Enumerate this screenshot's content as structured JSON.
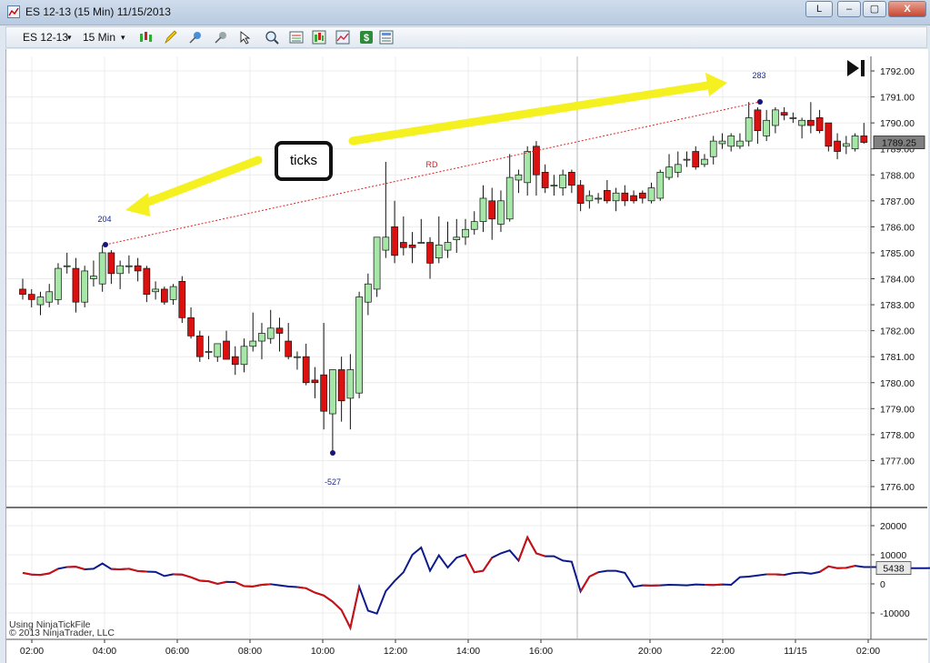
{
  "window": {
    "title": "ES 12-13 (15 Min)  11/15/2013",
    "buttons": [
      "L",
      "–",
      "▢",
      "X"
    ]
  },
  "toolbar": {
    "instrument": "ES 12-13",
    "interval": "15 Min",
    "icons": [
      "bar-style-icon",
      "pencil-draw-icon",
      "pin-icon",
      "pin-gray-icon",
      "pointer-icon",
      "zoom-icon",
      "data-box-icon",
      "chart-style-icon",
      "strategy-icon",
      "money-icon",
      "properties-icon"
    ]
  },
  "annotation": {
    "callout": "ticks",
    "start_value": "204",
    "end_value": "283",
    "low_value": "-527",
    "line_label": "RD"
  },
  "price_panel": {
    "ticks": [
      "1792.00",
      "1791.00",
      "1790.00",
      "1789.00",
      "1788.00",
      "1787.00",
      "1786.00",
      "1785.00",
      "1784.00",
      "1783.00",
      "1782.00",
      "1781.00",
      "1780.00",
      "1779.00",
      "1778.00",
      "1777.00",
      "1776.00"
    ],
    "last_price": "1789.25"
  },
  "indicator_panel": {
    "ticks": [
      "20000",
      "10000",
      "0",
      "-10000"
    ],
    "last_value": "5438"
  },
  "time_axis": [
    "02:00",
    "04:00",
    "06:00",
    "08:00",
    "10:00",
    "12:00",
    "14:00",
    "16:00",
    "20:00",
    "22:00",
    "11/15",
    "02:00"
  ],
  "credits": {
    "line1": "Using NinjaTickFile",
    "line2": "© 2013 NinjaTrader, LLC"
  },
  "colors": {
    "up_candle": "#a6e6a6",
    "down_candle": "#dd1010",
    "indicator_blue": "#0d1a8a",
    "indicator_red": "#cc1111",
    "arrow_yellow": "#f5f020"
  },
  "chart_data": {
    "type": "candlestick",
    "x_axis": "time (15-min bars)",
    "y_range": [
      1775.5,
      1792.5
    ],
    "candles": [
      {
        "o": 1783.6,
        "h": 1784.0,
        "l": 1783.2,
        "c": 1783.4
      },
      {
        "o": 1783.4,
        "h": 1783.6,
        "l": 1782.9,
        "c": 1783.2
      },
      {
        "o": 1783.0,
        "h": 1783.5,
        "l": 1782.6,
        "c": 1783.3
      },
      {
        "o": 1783.1,
        "h": 1783.8,
        "l": 1782.9,
        "c": 1783.5
      },
      {
        "o": 1783.2,
        "h": 1784.6,
        "l": 1783.0,
        "c": 1784.4
      },
      {
        "o": 1784.5,
        "h": 1785.0,
        "l": 1784.2,
        "c": 1784.5
      },
      {
        "o": 1784.4,
        "h": 1784.8,
        "l": 1782.7,
        "c": 1783.1
      },
      {
        "o": 1783.1,
        "h": 1784.5,
        "l": 1782.9,
        "c": 1784.3
      },
      {
        "o": 1784.0,
        "h": 1784.7,
        "l": 1783.7,
        "c": 1784.1
      },
      {
        "o": 1783.8,
        "h": 1785.3,
        "l": 1783.5,
        "c": 1785.0
      },
      {
        "o": 1785.0,
        "h": 1785.1,
        "l": 1783.8,
        "c": 1784.2
      },
      {
        "o": 1784.2,
        "h": 1784.7,
        "l": 1783.6,
        "c": 1784.5
      },
      {
        "o": 1784.5,
        "h": 1784.9,
        "l": 1784.2,
        "c": 1784.5
      },
      {
        "o": 1784.5,
        "h": 1784.8,
        "l": 1783.9,
        "c": 1784.3
      },
      {
        "o": 1784.4,
        "h": 1784.5,
        "l": 1783.1,
        "c": 1783.4
      },
      {
        "o": 1783.5,
        "h": 1783.9,
        "l": 1783.2,
        "c": 1783.6
      },
      {
        "o": 1783.6,
        "h": 1783.7,
        "l": 1783.0,
        "c": 1783.1
      },
      {
        "o": 1783.2,
        "h": 1783.8,
        "l": 1783.0,
        "c": 1783.7
      },
      {
        "o": 1783.9,
        "h": 1784.1,
        "l": 1782.3,
        "c": 1782.5
      },
      {
        "o": 1782.5,
        "h": 1782.9,
        "l": 1781.7,
        "c": 1781.8
      },
      {
        "o": 1781.8,
        "h": 1782.0,
        "l": 1780.8,
        "c": 1781.0
      },
      {
        "o": 1781.2,
        "h": 1781.8,
        "l": 1780.9,
        "c": 1781.2
      },
      {
        "o": 1781.0,
        "h": 1781.5,
        "l": 1780.8,
        "c": 1781.5
      },
      {
        "o": 1781.6,
        "h": 1782.0,
        "l": 1780.9,
        "c": 1780.9
      },
      {
        "o": 1781.0,
        "h": 1781.4,
        "l": 1780.3,
        "c": 1780.7
      },
      {
        "o": 1780.7,
        "h": 1781.7,
        "l": 1780.4,
        "c": 1781.4
      },
      {
        "o": 1781.4,
        "h": 1782.7,
        "l": 1781.2,
        "c": 1781.6
      },
      {
        "o": 1781.6,
        "h": 1782.3,
        "l": 1780.9,
        "c": 1781.9
      },
      {
        "o": 1781.7,
        "h": 1782.8,
        "l": 1781.5,
        "c": 1782.1
      },
      {
        "o": 1782.1,
        "h": 1782.5,
        "l": 1781.2,
        "c": 1781.9
      },
      {
        "o": 1781.6,
        "h": 1782.3,
        "l": 1780.9,
        "c": 1781.0
      },
      {
        "o": 1781.0,
        "h": 1781.2,
        "l": 1780.5,
        "c": 1781.0
      },
      {
        "o": 1781.0,
        "h": 1781.5,
        "l": 1779.9,
        "c": 1780.0
      },
      {
        "o": 1780.1,
        "h": 1780.6,
        "l": 1779.4,
        "c": 1780.0
      },
      {
        "o": 1780.3,
        "h": 1782.3,
        "l": 1778.2,
        "c": 1778.9
      },
      {
        "o": 1778.8,
        "h": 1779.3,
        "l": 1777.3,
        "c": 1780.5
      },
      {
        "o": 1780.5,
        "h": 1781.0,
        "l": 1778.5,
        "c": 1779.3
      },
      {
        "o": 1779.4,
        "h": 1781.1,
        "l": 1778.2,
        "c": 1780.5
      },
      {
        "o": 1779.6,
        "h": 1783.5,
        "l": 1779.4,
        "c": 1783.3
      },
      {
        "o": 1783.1,
        "h": 1784.2,
        "l": 1782.6,
        "c": 1783.8
      },
      {
        "o": 1783.6,
        "h": 1785.4,
        "l": 1783.3,
        "c": 1785.6
      },
      {
        "o": 1785.1,
        "h": 1788.5,
        "l": 1784.8,
        "c": 1785.6
      },
      {
        "o": 1786.0,
        "h": 1787.0,
        "l": 1784.6,
        "c": 1784.9
      },
      {
        "o": 1785.4,
        "h": 1786.4,
        "l": 1784.9,
        "c": 1785.2
      },
      {
        "o": 1785.3,
        "h": 1785.8,
        "l": 1784.6,
        "c": 1785.2
      },
      {
        "o": 1785.4,
        "h": 1786.3,
        "l": 1785.4,
        "c": 1785.4
      },
      {
        "o": 1785.4,
        "h": 1785.6,
        "l": 1784.0,
        "c": 1784.6
      },
      {
        "o": 1784.8,
        "h": 1786.4,
        "l": 1784.6,
        "c": 1785.3
      },
      {
        "o": 1785.1,
        "h": 1786.2,
        "l": 1784.8,
        "c": 1785.4
      },
      {
        "o": 1785.5,
        "h": 1786.3,
        "l": 1785.0,
        "c": 1785.6
      },
      {
        "o": 1785.6,
        "h": 1786.3,
        "l": 1785.3,
        "c": 1785.9
      },
      {
        "o": 1785.9,
        "h": 1786.6,
        "l": 1785.7,
        "c": 1786.2
      },
      {
        "o": 1786.2,
        "h": 1787.6,
        "l": 1785.8,
        "c": 1787.1
      },
      {
        "o": 1787.0,
        "h": 1787.5,
        "l": 1785.5,
        "c": 1786.3
      },
      {
        "o": 1786.1,
        "h": 1787.4,
        "l": 1785.8,
        "c": 1787.0
      },
      {
        "o": 1786.3,
        "h": 1788.8,
        "l": 1786.2,
        "c": 1787.9
      },
      {
        "o": 1787.8,
        "h": 1788.2,
        "l": 1787.3,
        "c": 1788.0
      },
      {
        "o": 1787.7,
        "h": 1789.1,
        "l": 1787.2,
        "c": 1788.9
      },
      {
        "o": 1789.1,
        "h": 1789.3,
        "l": 1787.2,
        "c": 1788.0
      },
      {
        "o": 1788.1,
        "h": 1788.4,
        "l": 1787.3,
        "c": 1787.5
      },
      {
        "o": 1787.6,
        "h": 1788.0,
        "l": 1787.2,
        "c": 1787.6
      },
      {
        "o": 1787.5,
        "h": 1788.2,
        "l": 1787.2,
        "c": 1788.0
      },
      {
        "o": 1788.1,
        "h": 1788.2,
        "l": 1787.3,
        "c": 1787.6
      },
      {
        "o": 1787.6,
        "h": 1787.8,
        "l": 1786.6,
        "c": 1786.9
      },
      {
        "o": 1787.0,
        "h": 1787.4,
        "l": 1786.7,
        "c": 1787.2
      },
      {
        "o": 1787.1,
        "h": 1787.3,
        "l": 1786.9,
        "c": 1787.1
      },
      {
        "o": 1787.4,
        "h": 1787.8,
        "l": 1786.9,
        "c": 1787.0
      },
      {
        "o": 1787.0,
        "h": 1787.5,
        "l": 1786.6,
        "c": 1787.3
      },
      {
        "o": 1787.3,
        "h": 1787.6,
        "l": 1786.8,
        "c": 1787.0
      },
      {
        "o": 1787.2,
        "h": 1787.4,
        "l": 1786.9,
        "c": 1787.0
      },
      {
        "o": 1787.3,
        "h": 1787.4,
        "l": 1786.9,
        "c": 1787.1
      },
      {
        "o": 1787.0,
        "h": 1787.7,
        "l": 1786.9,
        "c": 1787.5
      },
      {
        "o": 1787.1,
        "h": 1788.2,
        "l": 1787.0,
        "c": 1788.1
      },
      {
        "o": 1787.9,
        "h": 1788.8,
        "l": 1787.8,
        "c": 1788.3
      },
      {
        "o": 1788.1,
        "h": 1788.9,
        "l": 1787.9,
        "c": 1788.4
      },
      {
        "o": 1788.6,
        "h": 1788.9,
        "l": 1788.3,
        "c": 1788.6
      },
      {
        "o": 1788.9,
        "h": 1789.1,
        "l": 1788.2,
        "c": 1788.3
      },
      {
        "o": 1788.4,
        "h": 1788.8,
        "l": 1788.3,
        "c": 1788.6
      },
      {
        "o": 1788.7,
        "h": 1789.5,
        "l": 1788.4,
        "c": 1789.3
      },
      {
        "o": 1789.2,
        "h": 1789.6,
        "l": 1789.0,
        "c": 1789.3
      },
      {
        "o": 1789.1,
        "h": 1789.6,
        "l": 1788.9,
        "c": 1789.5
      },
      {
        "o": 1789.1,
        "h": 1789.6,
        "l": 1789.0,
        "c": 1789.3
      },
      {
        "o": 1789.3,
        "h": 1790.8,
        "l": 1789.1,
        "c": 1790.2
      },
      {
        "o": 1790.5,
        "h": 1790.6,
        "l": 1789.2,
        "c": 1789.7
      },
      {
        "o": 1789.5,
        "h": 1790.5,
        "l": 1789.3,
        "c": 1790.1
      },
      {
        "o": 1789.9,
        "h": 1790.6,
        "l": 1789.6,
        "c": 1790.5
      },
      {
        "o": 1790.4,
        "h": 1790.6,
        "l": 1790.1,
        "c": 1790.3
      },
      {
        "o": 1790.2,
        "h": 1790.4,
        "l": 1790.0,
        "c": 1790.2
      },
      {
        "o": 1789.9,
        "h": 1790.2,
        "l": 1789.4,
        "c": 1790.1
      },
      {
        "o": 1790.1,
        "h": 1790.8,
        "l": 1789.6,
        "c": 1789.9
      },
      {
        "o": 1790.2,
        "h": 1790.5,
        "l": 1789.6,
        "c": 1789.7
      },
      {
        "o": 1790.0,
        "h": 1790.0,
        "l": 1788.9,
        "c": 1789.1
      },
      {
        "o": 1789.3,
        "h": 1789.6,
        "l": 1788.6,
        "c": 1788.9
      },
      {
        "o": 1789.1,
        "h": 1789.5,
        "l": 1788.8,
        "c": 1789.2
      },
      {
        "o": 1789.0,
        "h": 1789.6,
        "l": 1788.9,
        "c": 1789.5
      },
      {
        "o": 1789.5,
        "h": 1790.0,
        "l": 1789.2,
        "c": 1789.25
      }
    ],
    "indicator_y_range": [
      -15000,
      24000
    ],
    "indicator": [
      3800,
      3200,
      3100,
      3600,
      5200,
      5800,
      5900,
      5000,
      5200,
      7000,
      5100,
      5000,
      5200,
      4400,
      4200,
      4100,
      2700,
      3300,
      3200,
      2300,
      1100,
      900,
      0,
      700,
      600,
      -800,
      -900,
      -300,
      -100,
      -500,
      -900,
      -1100,
      -1500,
      -3000,
      -4000,
      -6100,
      -9000,
      -15100,
      -1000,
      -9200,
      -10200,
      -2500,
      1000,
      4000,
      10000,
      12500,
      4500,
      9800,
      5600,
      9000,
      10000,
      4000,
      4500,
      9000,
      10500,
      11500,
      8000,
      16000,
      10500,
      9500,
      9500,
      8000,
      7600,
      -2600,
      2500,
      4000,
      4500,
      4500,
      3800,
      -1000,
      -500,
      -600,
      -500,
      -300,
      -400,
      -500,
      -200,
      -300,
      -400,
      -200,
      -300,
      2300,
      2500,
      2900,
      3300,
      3300,
      3100,
      3700,
      3900,
      3500,
      4100,
      6000,
      5400,
      5500,
      6200,
      5800,
      5800,
      5800,
      5600,
      5400,
      5400,
      5400,
      5400,
      5438
    ],
    "red_segments": [
      [
        0,
        2
      ],
      [
        3,
        3
      ],
      [
        5,
        6
      ],
      [
        10,
        13
      ],
      [
        17,
        22
      ],
      [
        24,
        27
      ],
      [
        31,
        37
      ],
      [
        50,
        52
      ],
      [
        56,
        58
      ],
      [
        63,
        64
      ],
      [
        70,
        71
      ],
      [
        77,
        78
      ],
      [
        84,
        85
      ],
      [
        90,
        93
      ]
    ]
  }
}
